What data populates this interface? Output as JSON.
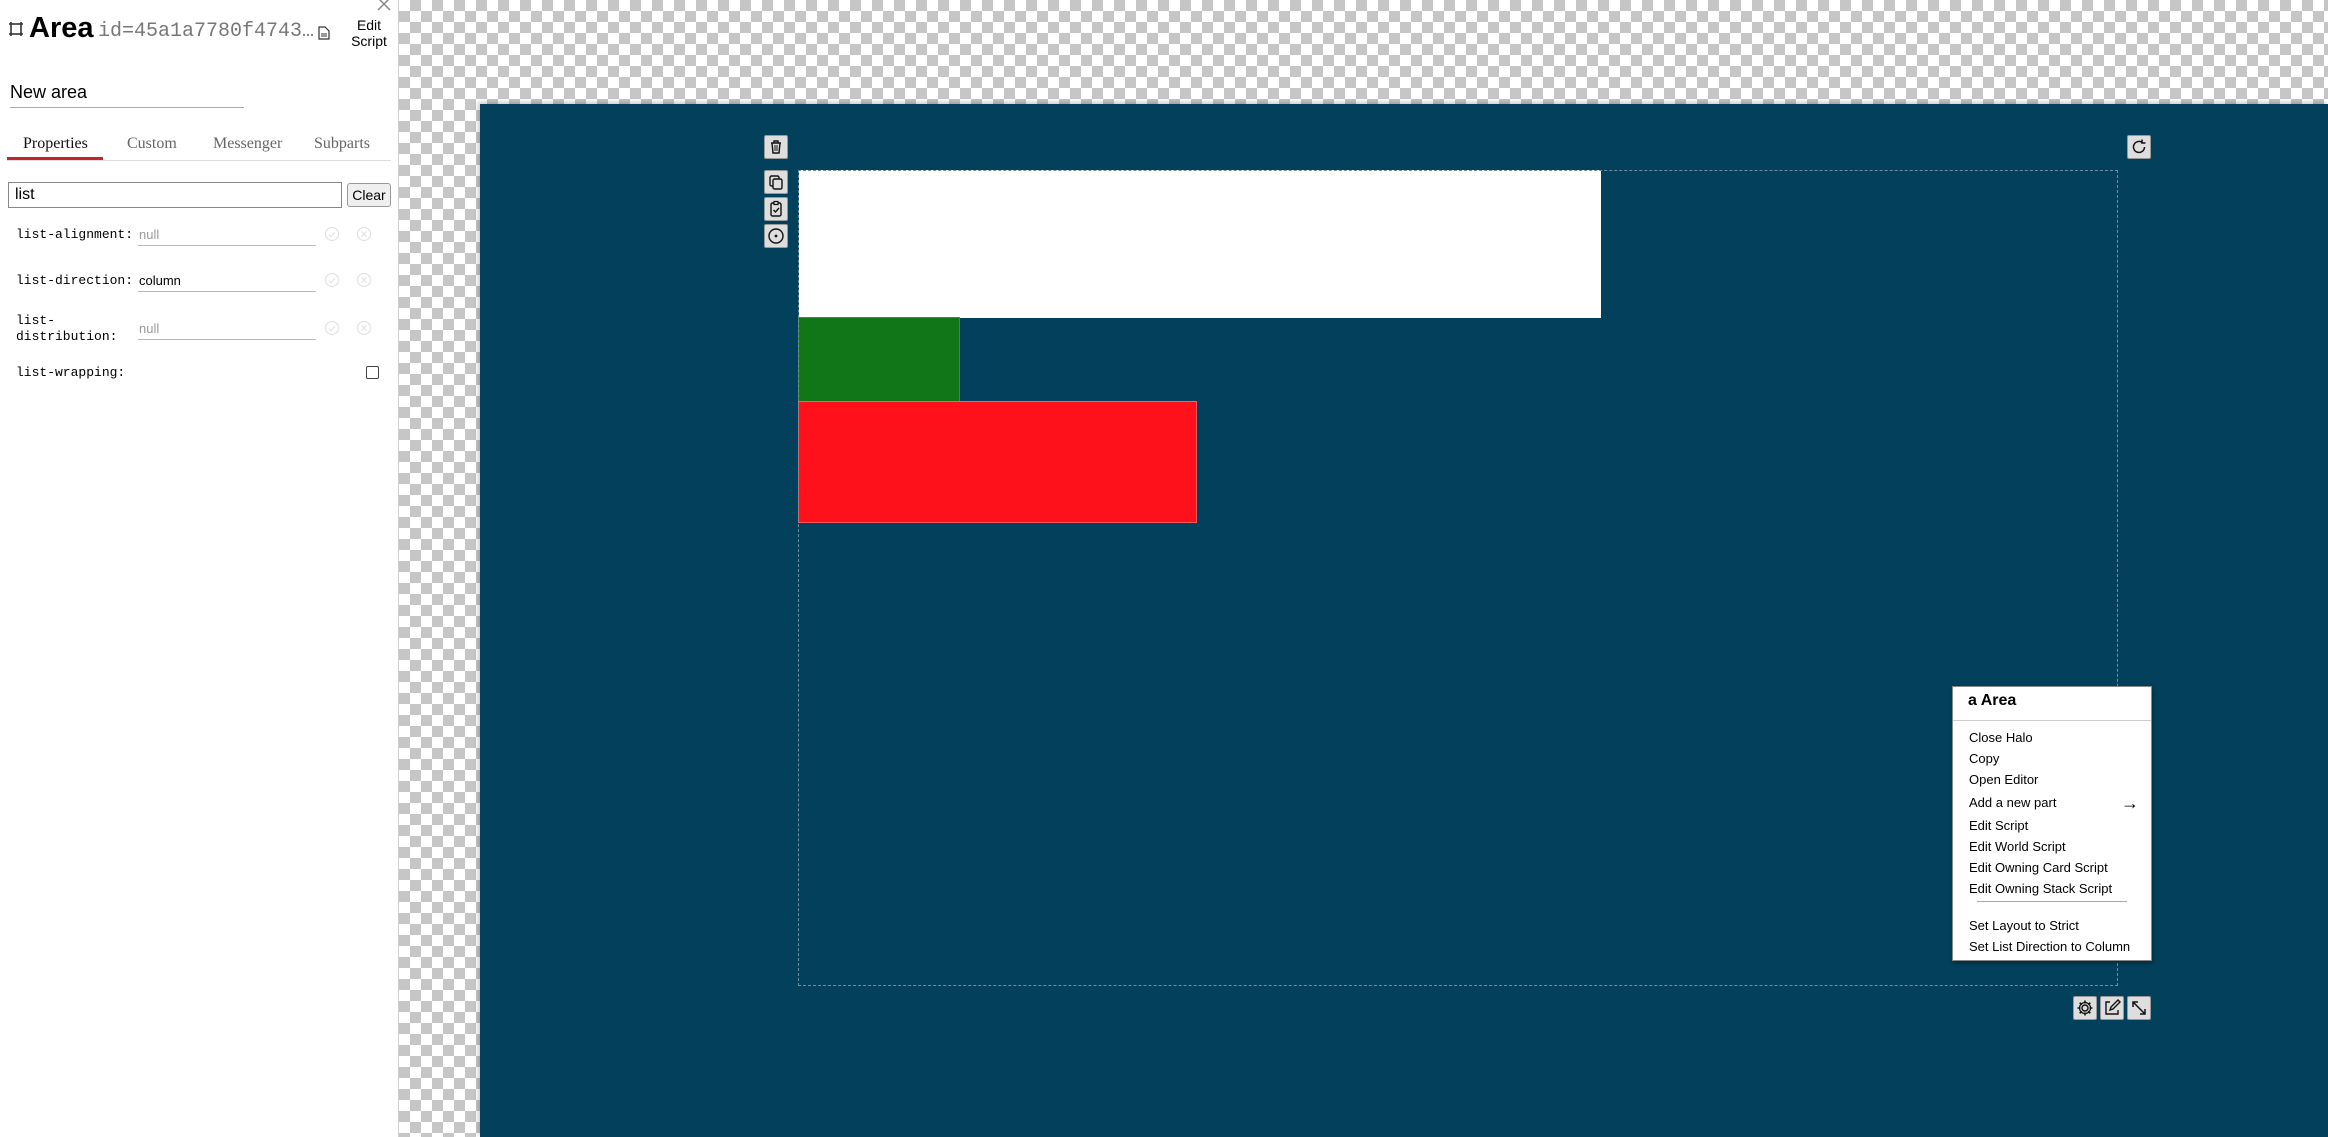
{
  "editor": {
    "title": "Area",
    "id_text": "id=45a1a7780f4743a7...",
    "edit_script_label": "Edit Script",
    "name_value": "New area",
    "tabs": [
      {
        "label": "Properties"
      },
      {
        "label": "Custom"
      },
      {
        "label": "Messenger"
      },
      {
        "label": "Subparts"
      }
    ],
    "search_value": "list",
    "clear_label": "Clear",
    "properties": [
      {
        "name": "list-alignment:",
        "value": "",
        "placeholder": "null"
      },
      {
        "name": "list-direction:",
        "value": "column",
        "placeholder": ""
      },
      {
        "name": "list-distribution:",
        "value": "",
        "placeholder": "null"
      },
      {
        "name": "list-wrapping:",
        "checked": false
      }
    ]
  },
  "canvas": {
    "stage_color": "#02405b",
    "boxes": [
      {
        "name": "white-box",
        "color": "#ffffff"
      },
      {
        "name": "green-box",
        "color": "#107617"
      },
      {
        "name": "red-box",
        "color": "#fe111a"
      }
    ],
    "halo_icons": [
      "trash-icon",
      "copy-icon",
      "clipboard-check-icon",
      "target-icon",
      "rotate-icon",
      "gear-icon",
      "edit-icon",
      "resize-icon"
    ]
  },
  "context_menu": {
    "title": "a Area",
    "items": [
      "Close Halo",
      "Copy",
      "Open Editor",
      "Add a new part",
      "Edit Script",
      "Edit World Script",
      "Edit Owning Card Script",
      "Edit Owning Stack Script",
      "Set Layout to Strict",
      "Set List Direction to Column"
    ],
    "submenu_arrow": "→"
  }
}
